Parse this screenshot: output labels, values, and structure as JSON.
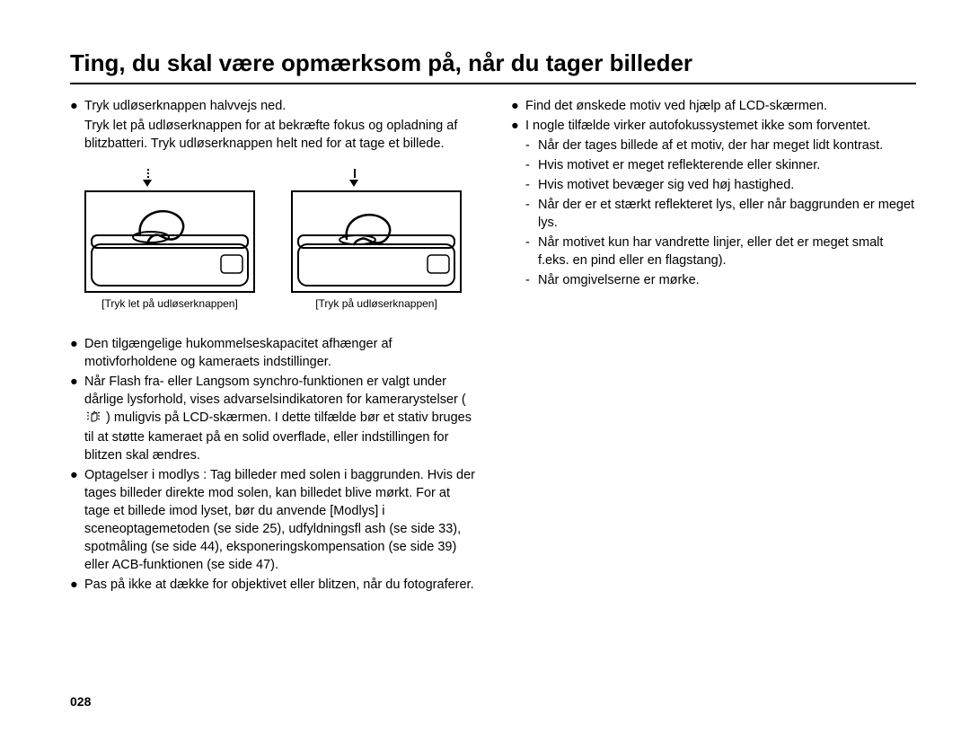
{
  "title": "Ting, du skal være opmærksom på, når du tager billeder",
  "left": {
    "b1": "Tryk udløserknappen halvvejs ned.",
    "b1_cont": "Tryk let på udløserknappen for at bekræfte fokus og opladning af blitzbatteri. Tryk udløserknappen helt ned for at tage et billede.",
    "fig1_caption": "[Tryk let på udløserknappen]",
    "fig2_caption": "[Tryk på udløserknappen]",
    "b2": "Den tilgængelige hukommelseskapacitet afhænger af motivforholdene og kameraets indstillinger.",
    "b3_a": "Når Flash fra- eller Langsom synchro-funktionen er valgt under dårlige lysforhold, vises advarselsindikatoren for kamerarystelser (",
    "b3_b": ") muligvis på LCD-skærmen. I dette tilfælde bør et stativ bruges til at støtte kameraet på en solid overflade, eller indstillingen for blitzen skal ændres.",
    "b4_lead": "Optagelser i modlys :",
    "b4_body1": "Tag billeder med solen i baggrunden. Hvis der tages billeder direkte mod solen, kan billedet blive mørkt. For at tage et billede imod lyset, bør du anvende [Modlys] i sceneoptagemetoden (se side 25), udfyldningsfl ash (se side 33), spotmåling (se side 44), eksponeringskompensation (se side 39) eller ACB-funktionen (se side 47).",
    "b5": "Pas på ikke at dække for objektivet eller blitzen, når du fotograferer."
  },
  "right": {
    "b1": "Find det ønskede motiv ved hjælp af LCD-skærmen.",
    "b2": "I nogle tilfælde virker autofokussystemet ikke som forventet.",
    "d1": "Når der tages billede af et motiv, der har meget lidt kontrast.",
    "d2": "Hvis motivet er meget reflekterende eller skinner.",
    "d3": "Hvis motivet bevæger sig ved høj hastighed.",
    "d4": "Når der er et stærkt reflekteret lys, eller når baggrunden er meget lys.",
    "d5": "Når motivet kun har vandrette linjer, eller det er meget smalt f.eks. en pind eller en flagstang).",
    "d6": "Når omgivelserne er mørke."
  },
  "page_number": "028"
}
